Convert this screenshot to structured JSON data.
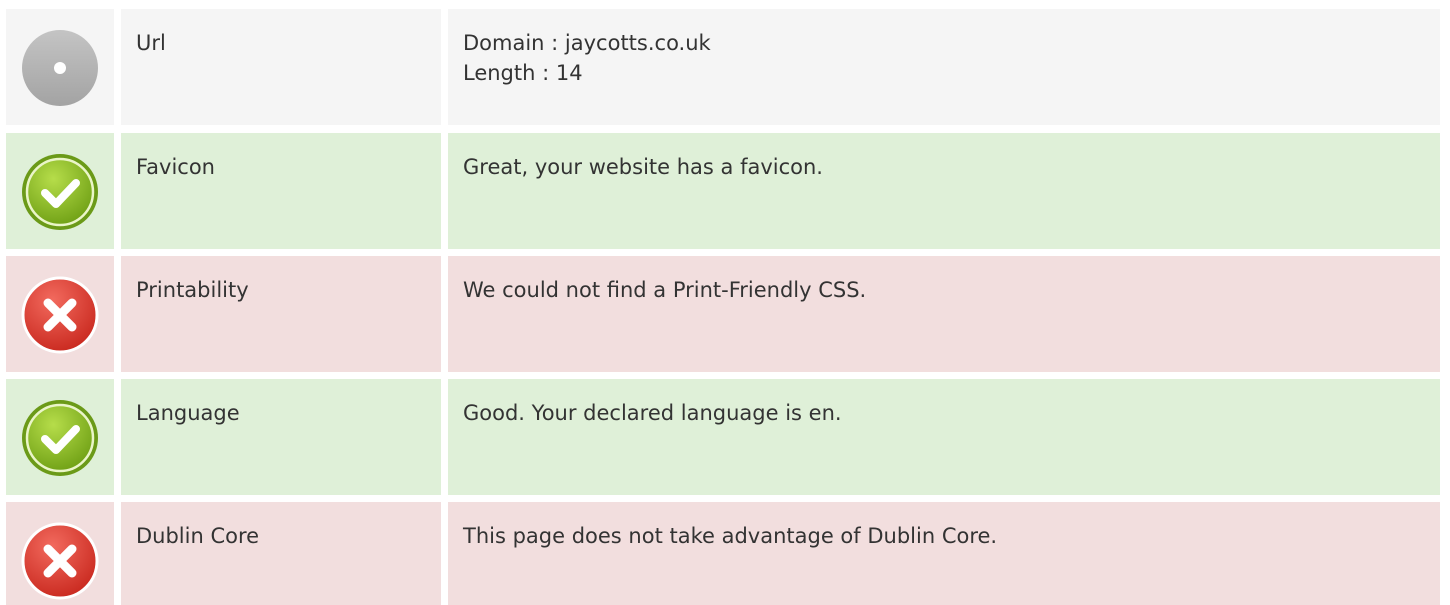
{
  "colors": {
    "neutral_bg": "#f5f5f5",
    "good_bg": "#dff0d8",
    "bad_bg": "#f2dede"
  },
  "rows": [
    {
      "status": "neutral",
      "icon": "neutral-circle-icon",
      "label": "Url",
      "value_lines": [
        "Domain : jaycotts.co.uk",
        "Length : 14"
      ]
    },
    {
      "status": "good",
      "icon": "check-circle-icon",
      "label": "Favicon",
      "value_lines": [
        "Great, your website has a favicon."
      ]
    },
    {
      "status": "bad",
      "icon": "x-circle-icon",
      "label": "Printability",
      "value_lines": [
        "We could not find a Print-Friendly CSS."
      ]
    },
    {
      "status": "good",
      "icon": "check-circle-icon",
      "label": "Language",
      "value_lines": [
        "Good. Your declared language is en."
      ]
    },
    {
      "status": "bad",
      "icon": "x-circle-icon",
      "label": "Dublin Core",
      "value_lines": [
        "This page does not take advantage of Dublin Core."
      ]
    }
  ]
}
